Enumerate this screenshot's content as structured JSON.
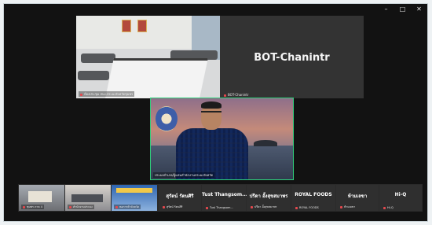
{
  "window_controls": {
    "minimize": "–",
    "maximize": "□",
    "close": "✕"
  },
  "tiles": {
    "room_label": "ห้องประชุม สนง.ประมงจังหวัดชุมพร",
    "bot_name": "BOT-Chanintr",
    "bot_label": "BOT-Chanintr",
    "speaker_label": "ประมงอำเภอ/ผู้แทนสำนักงานประมงจังหวัด"
  },
  "thumbnails": [
    {
      "label": "ชุมพร ภาค 4"
    },
    {
      "label": "สำนักงานประมง"
    },
    {
      "label": "หอการค้าจังหวัด"
    }
  ],
  "name_tiles": [
    {
      "name": "สุรัตน์ รัตนศิริ",
      "label": "สุรัตน์ รัตนศิริ"
    },
    {
      "name": "Tust Thangsom...",
      "label": "Tust Thangsom..."
    },
    {
      "name": "ปรีดา อั้งสุขสมาพร",
      "label": "ปรีดา อั้งสุขสมาพร"
    },
    {
      "name": "ROYAL FOODS",
      "label": "ROYAL FOODS"
    },
    {
      "name": "ห้ามเลขา",
      "label": "ห้ามเลขา"
    },
    {
      "name": "Hi-Q",
      "label": "Hi-Q"
    }
  ],
  "colors": {
    "active_speaker_border": "#2fd07b",
    "mic_muted": "#e5484d"
  }
}
